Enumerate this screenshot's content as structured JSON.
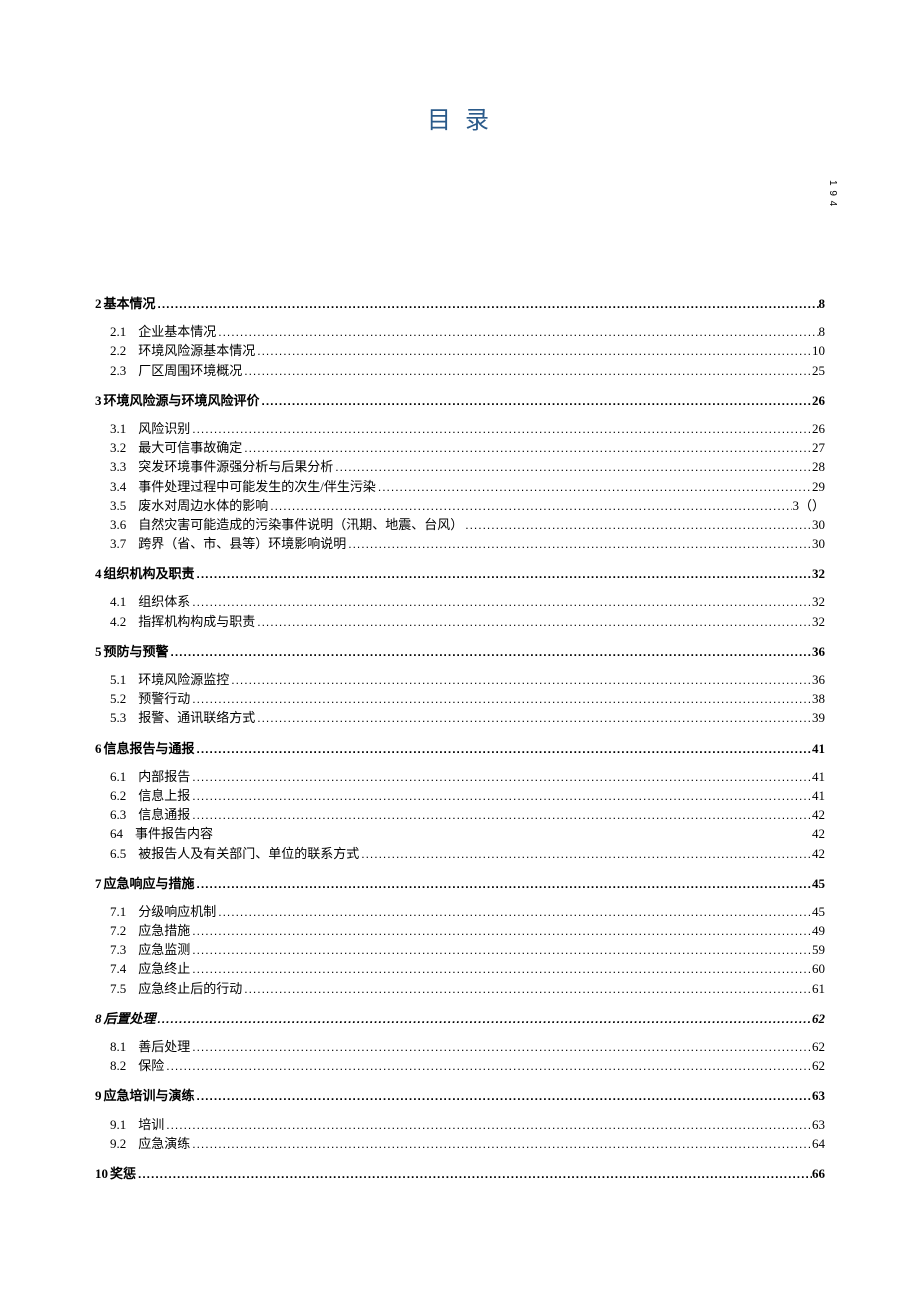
{
  "title": "目 录",
  "side_number": "1 9 4",
  "toc": [
    {
      "type": "section",
      "num": "2",
      "label": "基本情况",
      "page": "8"
    },
    {
      "type": "sub",
      "num": "2.1",
      "label": "企业基本情况",
      "page": "8"
    },
    {
      "type": "sub",
      "num": "2.2",
      "label": "环境风险源基本情况",
      "page": "10"
    },
    {
      "type": "sub",
      "num": "2.3",
      "label": "厂区周围环境概况",
      "page": "25"
    },
    {
      "type": "section",
      "num": "3",
      "label": "环境风险源与环境风险评价",
      "page": "26"
    },
    {
      "type": "sub",
      "num": "3.1",
      "label": "风险识别",
      "page": "26"
    },
    {
      "type": "sub",
      "num": "3.2",
      "label": "最大可信事故确定",
      "page": "27"
    },
    {
      "type": "sub",
      "num": "3.3",
      "label": "突发环境事件源强分析与后果分析",
      "page": "28"
    },
    {
      "type": "sub",
      "num": "3.4",
      "label": "事件处理过程中可能发生的次生/伴生污染",
      "page": "29"
    },
    {
      "type": "sub",
      "num": "3.5",
      "label": "废水对周边水体的影响",
      "page": "3（）"
    },
    {
      "type": "sub",
      "num": "3.6",
      "label": "自然灾害可能造成的污染事件说明（汛期、地震、台风）",
      "page": "30"
    },
    {
      "type": "sub",
      "num": "3.7",
      "label": "跨界（省、市、县等）环境影响说明",
      "page": "30"
    },
    {
      "type": "section",
      "num": "4",
      "label": "组织机构及职责",
      "page": "32"
    },
    {
      "type": "sub",
      "num": "4.1",
      "label": "组织体系",
      "page": "32"
    },
    {
      "type": "sub",
      "num": "4.2",
      "label": "指挥机构构成与职责",
      "page": "32"
    },
    {
      "type": "section",
      "num": "5",
      "label": "预防与预警",
      "page": "36"
    },
    {
      "type": "sub",
      "num": "5.1",
      "label": "环境风险源监控",
      "page": "36"
    },
    {
      "type": "sub",
      "num": "5.2",
      "label": "预警行动",
      "page": "38"
    },
    {
      "type": "sub",
      "num": "5.3",
      "label": "报警、通讯联络方式",
      "page": "39"
    },
    {
      "type": "section",
      "num": "6",
      "label": "信息报告与通报",
      "page": "41"
    },
    {
      "type": "sub",
      "num": "6.1",
      "label": "内部报告",
      "page": "41"
    },
    {
      "type": "sub",
      "num": "6.2",
      "label": "信息上报",
      "page": "41"
    },
    {
      "type": "sub",
      "num": "6.3",
      "label": "信息通报",
      "page": "42"
    },
    {
      "type": "sub_nodots",
      "num": "64",
      "label": "事件报告内容",
      "page": "42"
    },
    {
      "type": "sub",
      "num": "6.5",
      "label": "被报告人及有关部门、单位的联系方式",
      "page": "42"
    },
    {
      "type": "section",
      "num": "7",
      "label": "应急响应与措施",
      "page": "45"
    },
    {
      "type": "sub",
      "num": "7.1",
      "label": "分级响应机制",
      "page": "45"
    },
    {
      "type": "sub",
      "num": "7.2",
      "label": "应急措施",
      "page": "49"
    },
    {
      "type": "sub",
      "num": "7.3",
      "label": "应急监测",
      "page": "59"
    },
    {
      "type": "sub",
      "num": "7.4",
      "label": "应急终止",
      "page": " 60"
    },
    {
      "type": "sub",
      "num": "7.5",
      "label": "应急终止后的行动",
      "page": "61"
    },
    {
      "type": "section_italic",
      "num": "8",
      "label": "后置处理",
      "page": "62"
    },
    {
      "type": "sub",
      "num": "8.1",
      "label": "善后处理",
      "page": "62"
    },
    {
      "type": "sub",
      "num": "8.2",
      "label": "保险",
      "page": "62"
    },
    {
      "type": "section",
      "num": "9",
      "label": "应急培训与演练",
      "page": "63"
    },
    {
      "type": "sub",
      "num": "9.1",
      "label": "培训",
      "page": "63"
    },
    {
      "type": "sub",
      "num": "9.2",
      "label": "应急演练",
      "page": "64"
    },
    {
      "type": "section",
      "num": "10",
      "label": "奖惩",
      "page": "66"
    }
  ]
}
